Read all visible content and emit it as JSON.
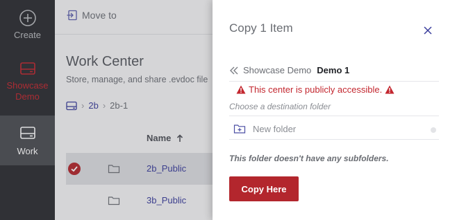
{
  "sidebar": {
    "items": [
      {
        "label": "Create",
        "icon": "plus-circle-icon"
      },
      {
        "label": "Showcase Demo",
        "icon": "drive-icon"
      },
      {
        "label": "Work",
        "icon": "drive-icon"
      }
    ]
  },
  "toolbar": {
    "move_to_label": "Move to"
  },
  "main": {
    "title": "Work Center",
    "subtitle": "Store, manage, and share .evdoc file",
    "breadcrumb": [
      "2b",
      "2b-1"
    ],
    "column_header": "Name",
    "rows": [
      {
        "name": "2b_Public",
        "selected": true
      },
      {
        "name": "3b_Public",
        "selected": false
      }
    ]
  },
  "dialog": {
    "title": "Copy 1 Item",
    "crumb_parent": "Showcase Demo",
    "crumb_current": "Demo 1",
    "warning": "This center is publicly accessible.",
    "choose_label": "Choose a destination folder",
    "new_folder_label": "New folder",
    "empty_message": "This folder doesn't have any subfolders.",
    "copy_button_label": "Copy Here"
  },
  "colors": {
    "accent": "#b3262d",
    "link": "#3a3d9c",
    "sidebar_bg": "#2b2d31"
  }
}
